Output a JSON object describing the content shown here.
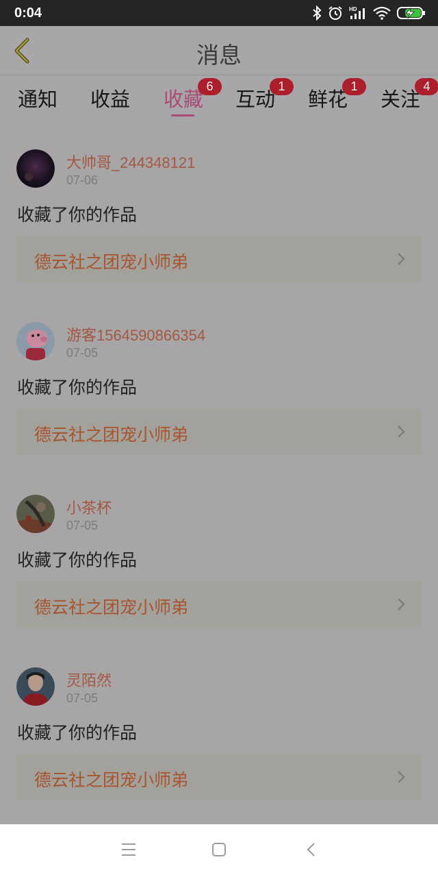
{
  "status_bar": {
    "time": "0:04",
    "icons": [
      "bluetooth-icon",
      "alarm-icon",
      "hd-signal-icon",
      "wifi-icon",
      "battery-charging-icon"
    ]
  },
  "header": {
    "title": "消息",
    "back_icon": "chevron-left-icon"
  },
  "tabs": [
    {
      "label": "通知"
    },
    {
      "label": "收益"
    },
    {
      "label": "收藏",
      "badge": "6",
      "active": true
    },
    {
      "label": "互动",
      "badge": "1"
    },
    {
      "label": "鲜花",
      "badge": "1"
    },
    {
      "label": "关注",
      "badge": "4"
    }
  ],
  "items": [
    {
      "user": "大帅哥_244348121",
      "date": "07-06",
      "action": "收藏了你的作品",
      "work": "德云社之团宠小师弟"
    },
    {
      "user": "游客1564590866354",
      "date": "07-05",
      "action": "收藏了你的作品",
      "work": "德云社之团宠小师弟"
    },
    {
      "user": "小茶杯",
      "date": "07-05",
      "action": "收藏了你的作品",
      "work": "德云社之团宠小师弟"
    },
    {
      "user": "灵陌然",
      "date": "07-05",
      "action": "收藏了你的作品",
      "work": "德云社之团宠小师弟"
    }
  ],
  "nav_bar": {
    "icons": [
      "menu-icon",
      "home-square-icon",
      "back-arrow-icon"
    ]
  },
  "colors": {
    "overlay_gray": "#a8a6a8",
    "active_tab": "#a94b76",
    "badge": "#ac1e2c",
    "username": "#a35843",
    "work_title": "#a7552f"
  }
}
